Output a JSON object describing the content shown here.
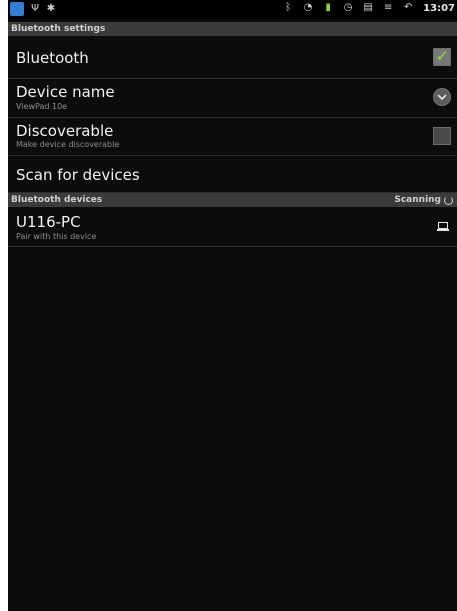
{
  "statusbar": {
    "time": "13:07",
    "icons_left": [
      "app-icon",
      "usb-icon",
      "android-debug-icon"
    ],
    "icons_right": [
      "bluetooth-icon",
      "wifi-icon",
      "battery-icon",
      "alarm-icon",
      "sd-card-icon",
      "signal-icon",
      "back-icon"
    ]
  },
  "bluetooth_settings": {
    "header": "Bluetooth settings",
    "items": [
      {
        "title": "Bluetooth",
        "summary": "",
        "control": "checkbox",
        "checked": true
      },
      {
        "title": "Device name",
        "summary": "ViewPad 10e",
        "control": "chevron"
      },
      {
        "title": "Discoverable",
        "summary": "Make device discoverable",
        "control": "checkbox",
        "checked": false
      },
      {
        "title": "Scan for devices",
        "summary": "",
        "control": "none"
      }
    ]
  },
  "bluetooth_devices": {
    "header": "Bluetooth devices",
    "status": "Scanning",
    "devices": [
      {
        "name": "U116-PC",
        "summary": "Pair with this device",
        "icon": "laptop-icon"
      }
    ]
  },
  "colors": {
    "background": "#0c0c0c",
    "header_bg": "#3b3b3b",
    "check_green": "#9bdc34"
  }
}
